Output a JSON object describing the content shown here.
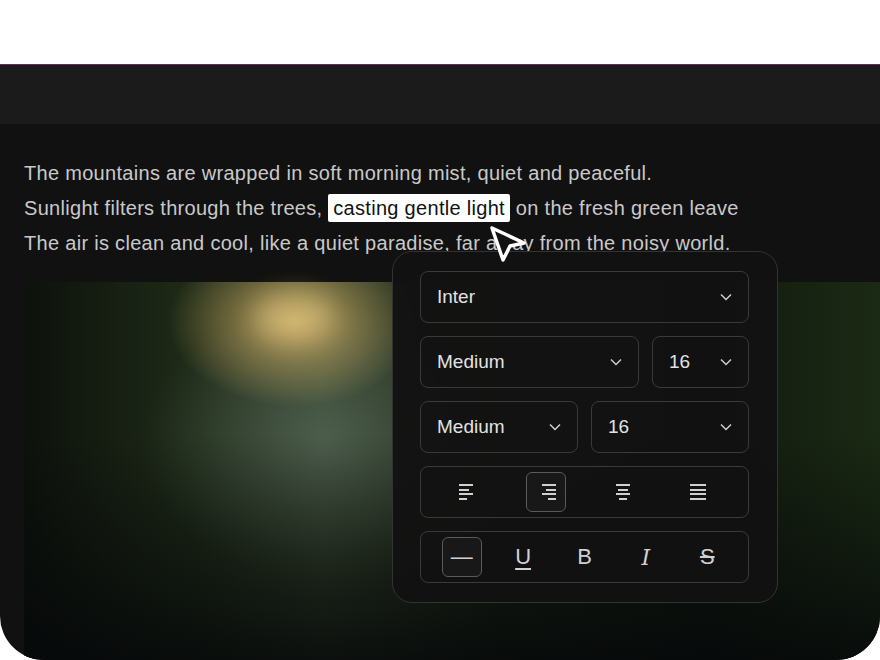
{
  "paragraph": {
    "lines": [
      [
        {
          "text": "The mountains are wrapped in soft morning mist, quiet and peaceful.",
          "selected": false
        }
      ],
      [
        {
          "text": "Sunlight filters through the trees, ",
          "selected": false
        },
        {
          "text": "casting gentle light",
          "selected": true
        },
        {
          "text": " on the fresh green leave",
          "selected": false
        }
      ],
      [
        {
          "text": "The air is clean and cool, like a quiet paradise, far away from the noisy world.",
          "selected": false
        }
      ]
    ]
  },
  "format_popover": {
    "font": "Inter",
    "rows": [
      {
        "weight": "Medium",
        "size": "16"
      },
      {
        "weight": "Medium",
        "size": "16"
      }
    ],
    "alignment": [
      {
        "kind": "left",
        "selected": false
      },
      {
        "kind": "right",
        "selected": true
      },
      {
        "kind": "center",
        "selected": false
      },
      {
        "kind": "justify",
        "selected": false
      }
    ],
    "styles": [
      {
        "kind": "none",
        "label": "—",
        "selected": true
      },
      {
        "kind": "underline",
        "label": "U",
        "selected": false
      },
      {
        "kind": "bold",
        "label": "B",
        "selected": false
      },
      {
        "kind": "italic",
        "label": "I",
        "selected": false
      },
      {
        "kind": "strike",
        "label": "S",
        "selected": false
      }
    ]
  }
}
